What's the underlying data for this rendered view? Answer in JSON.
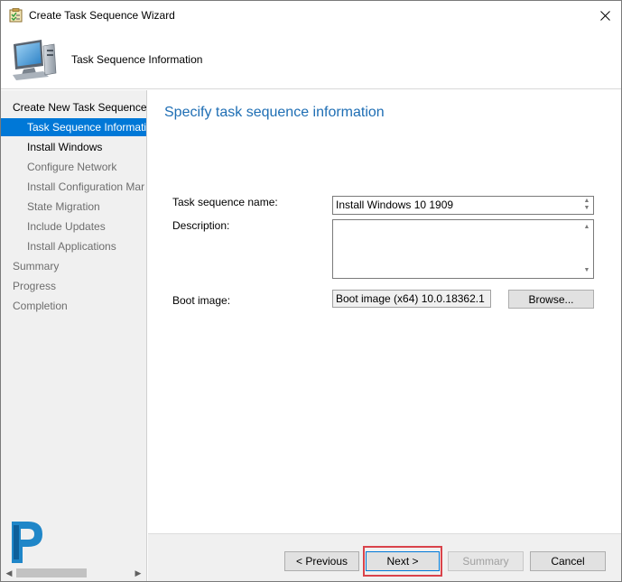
{
  "window": {
    "title": "Create Task Sequence Wizard"
  },
  "header": {
    "page_heading": "Task Sequence Information"
  },
  "nav": {
    "items": [
      {
        "label": "Create New Task Sequence",
        "level": 0,
        "state": "normal"
      },
      {
        "label": "Task Sequence Informatio",
        "level": 1,
        "state": "selected"
      },
      {
        "label": "Install Windows",
        "level": 1,
        "state": "active"
      },
      {
        "label": "Configure Network",
        "level": 1,
        "state": "normal"
      },
      {
        "label": "Install Configuration Mar",
        "level": 1,
        "state": "normal"
      },
      {
        "label": "State Migration",
        "level": 1,
        "state": "normal"
      },
      {
        "label": "Include Updates",
        "level": 1,
        "state": "normal"
      },
      {
        "label": "Install Applications",
        "level": 1,
        "state": "normal"
      },
      {
        "label": "Summary",
        "level": 0,
        "state": "normal"
      },
      {
        "label": "Progress",
        "level": 0,
        "state": "normal"
      },
      {
        "label": "Completion",
        "level": 0,
        "state": "normal"
      }
    ]
  },
  "main": {
    "heading": "Specify task sequence information",
    "name_label": "Task sequence name:",
    "name_value": "Install Windows 10 1909",
    "description_label": "Description:",
    "description_value": "",
    "boot_image_label": "Boot image:",
    "boot_image_value": "Boot image (x64) 10.0.18362.1",
    "browse_label": "Browse..."
  },
  "footer": {
    "previous_label": "< Previous",
    "next_label": "Next >",
    "summary_label": "Summary",
    "cancel_label": "Cancel"
  },
  "colors": {
    "accent": "#0078d7",
    "heading": "#1e6eb4",
    "highlight": "#d9434b"
  }
}
